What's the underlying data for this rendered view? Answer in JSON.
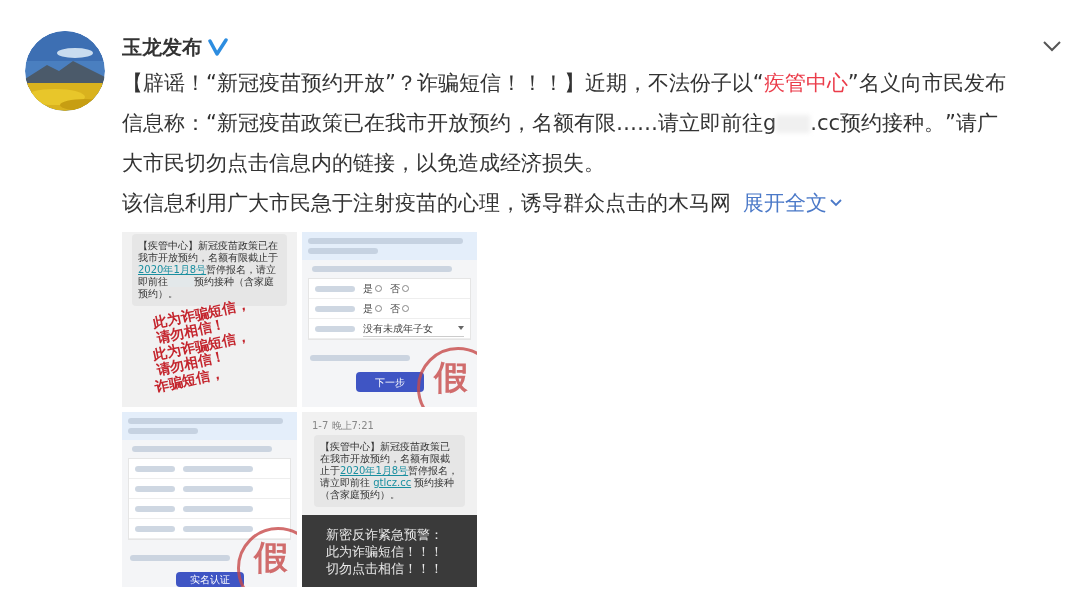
{
  "post": {
    "author": "玉龙发布",
    "verified": true,
    "paragraphs": [
      {
        "segments": [
          {
            "kind": "plain",
            "text": "【辟谣！“新冠疫苗预约开放”？诈骗短信！！！】近期，不法份子以“"
          },
          {
            "kind": "highlight",
            "text": "疾管中心"
          },
          {
            "kind": "plain",
            "text": "”名义向市民发布信息称：“新冠疫苗政策已在我市开放预约，名额有限……请立即前往g"
          },
          {
            "kind": "redacted"
          },
          {
            "kind": "plain",
            "text": ".cc预约接种。”请广大市民切勿点击信息内的链接，以免造成经济损失。"
          }
        ]
      },
      {
        "segments": [
          {
            "kind": "plain",
            "text": "该信息利用广大市民急于注射疫苗的心理，诱导群众点击的木马网"
          }
        ],
        "expand_link": "展开全文"
      }
    ],
    "images": [
      {
        "kind": "sms",
        "message": [
          {
            "kind": "plain",
            "text": "【疾管中心】新冠疫苗政策已在我市开放预约，名额有限截止于"
          },
          {
            "kind": "link",
            "text": "2020年1月8号"
          },
          {
            "kind": "plain",
            "text": "暂停报名，请立即前往"
          },
          {
            "kind": "redacted"
          },
          {
            "kind": "plain",
            "text": "预约接种（含家庭预约）。"
          }
        ],
        "warnings": [
          [
            "此为诈骗短信，",
            "请勿相信！"
          ],
          [
            "此为诈骗短信，",
            "请勿相信！"
          ],
          [
            "诈骗短信，"
          ]
        ]
      },
      {
        "kind": "form",
        "rows": [
          {
            "kind": "radio",
            "options": [
              {
                "label": "是",
                "selected": false
              },
              {
                "label": "否",
                "selected": false
              }
            ]
          },
          {
            "kind": "radio",
            "options": [
              {
                "label": "是",
                "selected": false
              },
              {
                "label": "否",
                "selected": false
              }
            ]
          },
          {
            "kind": "select",
            "value": "没有未成年子女"
          }
        ],
        "button": "下一步",
        "stamp": "假"
      },
      {
        "kind": "form",
        "rows": [
          {
            "kind": "input"
          },
          {
            "kind": "input"
          },
          {
            "kind": "input"
          },
          {
            "kind": "input"
          }
        ],
        "button": "实名认证",
        "stamp": "假"
      },
      {
        "kind": "sms_alert",
        "time": "1-7 晚上7:21",
        "message": [
          {
            "kind": "plain",
            "text": "【疾管中心】新冠疫苗政策已在我市开放预约，名额有限截止于"
          },
          {
            "kind": "link",
            "text": "2020年1月8号"
          },
          {
            "kind": "plain",
            "text": "暂停报名，请立即前往 "
          },
          {
            "kind": "link",
            "text": "gtlcz.cc"
          },
          {
            "kind": "plain",
            "text": " 预约接种（含家庭预约）。"
          }
        ],
        "alert": [
          "新密反诈紧急预警：",
          "此为诈骗短信！！！",
          "切勿点击相信！！！"
        ]
      }
    ]
  }
}
